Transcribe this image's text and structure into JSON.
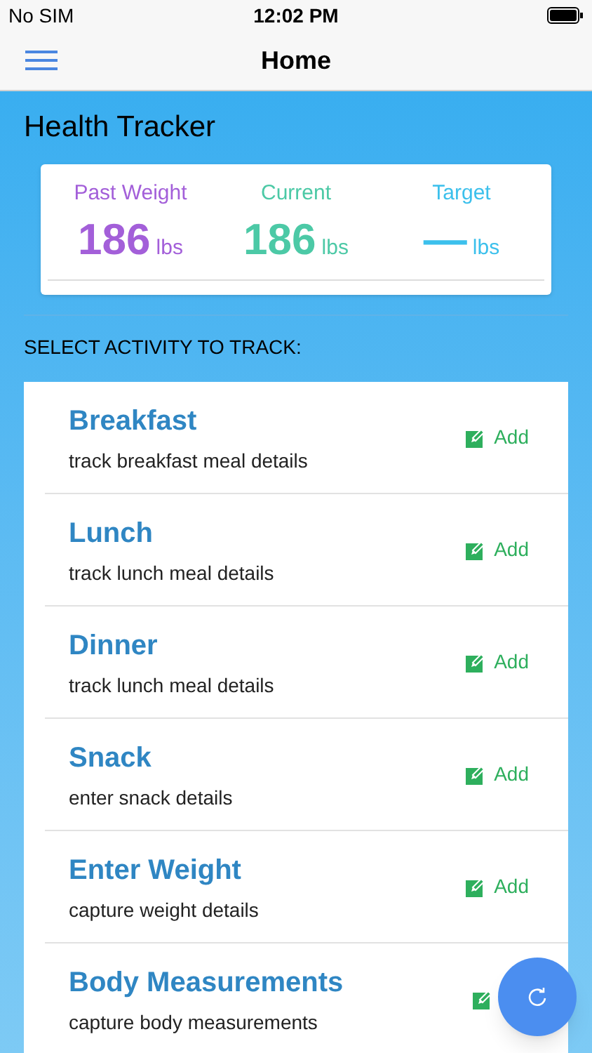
{
  "status_bar": {
    "carrier": "No SIM",
    "time": "12:02 PM"
  },
  "nav": {
    "title": "Home"
  },
  "app_title": "Health Tracker",
  "weights": [
    {
      "label": "Past Weight",
      "value": "186",
      "unit": "lbs",
      "color": "#a35fd9"
    },
    {
      "label": "Current",
      "value": "186",
      "unit": "lbs",
      "color": "#4cc9a6"
    },
    {
      "label": "Target",
      "value": "—",
      "unit": "lbs",
      "color": "#3cc0ec"
    }
  ],
  "section_label": "SELECT ACTIVITY TO TRACK:",
  "activities": [
    {
      "title": "Breakfast",
      "subtitle": "track breakfast meal details",
      "action": "Add"
    },
    {
      "title": "Lunch",
      "subtitle": "track lunch meal details",
      "action": "Add"
    },
    {
      "title": "Dinner",
      "subtitle": "track lunch meal details",
      "action": "Add"
    },
    {
      "title": "Snack",
      "subtitle": "enter snack details",
      "action": "Add"
    },
    {
      "title": "Enter Weight",
      "subtitle": "capture weight details",
      "action": "Add"
    },
    {
      "title": "Body Measurements",
      "subtitle": "capture body measurements"
    }
  ]
}
